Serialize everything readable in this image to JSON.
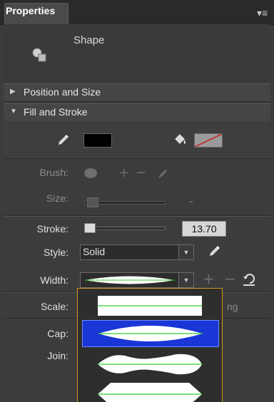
{
  "panel": {
    "tab_label": "Properties",
    "menu_glyph": "▾≡",
    "element_type": "Shape"
  },
  "sections": {
    "position_size": "Position and Size",
    "fill_stroke": "Fill and Stroke"
  },
  "fill": {
    "color": "#000000",
    "stroke_swatch": "none (red slash)"
  },
  "brush": {
    "label": "Brush:",
    "size_label": "Size:"
  },
  "stroke": {
    "label": "Stroke:",
    "value": "13.70"
  },
  "style": {
    "label": "Style:",
    "value": "Solid"
  },
  "width": {
    "label": "Width:"
  },
  "scale": {
    "label": "Scale:",
    "partial_text": "ng"
  },
  "cap": {
    "label": "Cap:"
  },
  "join": {
    "label": "Join:"
  },
  "width_profile_options": [
    {
      "name": "uniform",
      "selected": false
    },
    {
      "name": "width-profile-1",
      "selected": true
    },
    {
      "name": "width-profile-2",
      "selected": false
    },
    {
      "name": "width-profile-3",
      "selected": false
    }
  ],
  "colors": {
    "panel_bg": "#3c3c3c",
    "selection": "#1a36d6",
    "dropdown_border": "#d49a1b",
    "profile_line": "#2fd12f"
  }
}
